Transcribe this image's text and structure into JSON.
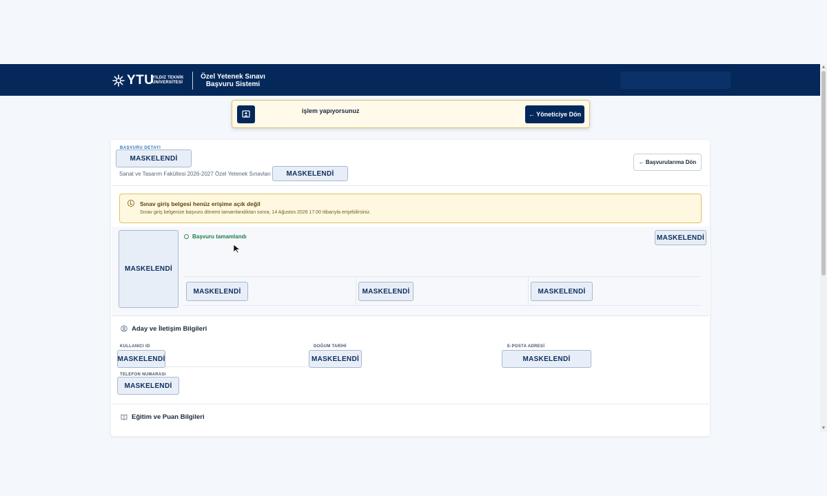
{
  "header": {
    "logo_text": "YTU",
    "university_name_line1": "YILDIZ TEKNİK",
    "university_name_line2": "ÜNİVERSİTESİ",
    "system_title_line1": "Özel Yetenek Sınavı",
    "system_title_line2": "Başvuru Sistemi"
  },
  "banner": {
    "text": "işlem yapıyorsunuz",
    "button_label": "← Yöneticiye Dön"
  },
  "card": {
    "eyebrow": "BAŞVURU DETAYI",
    "title_masked": "MASKELENDİ",
    "subtitle": "Sanat ve Tasarım Fakültesi 2026-2027 Özel Yetenek Sınavları",
    "subtitle_masked": "MASKELENDİ",
    "back_button_label": "← Başvurularıma Dön"
  },
  "warning": {
    "title": "Sınav giriş belgesi henüz erişime açık değil",
    "description": "Sınav giriş belgenize başvuru dönemi tamamlandıktan sonra, 14 Ağustos 2026 17:00 itibarıyla erişebilirsiniz."
  },
  "status": {
    "photo_masked": "MASKELENDİ",
    "status_text": "Başvuru tamamlandı",
    "top_right_masked": "MASKELENDİ",
    "stats": [
      "MASKELENDİ",
      "MASKELENDİ",
      "MASKELENDİ"
    ]
  },
  "contact_section": {
    "title": "Aday ve İletişim Bilgileri",
    "fields": [
      {
        "label": "KULLANICI ID",
        "value": "MASKELENDİ"
      },
      {
        "label": "DOĞUM TARİHİ",
        "value": "MASKELENDİ"
      },
      {
        "label": "E-POSTA ADRESİ",
        "value": "MASKELENDİ"
      },
      {
        "label": "TELEFON NUMARASI",
        "value": "MASKELENDİ"
      }
    ]
  },
  "education_section": {
    "title": "Eğitim ve Puan Bilgileri"
  },
  "colors": {
    "header_bg": "#04285a",
    "banner_bg": "#fffaea",
    "warning_bg": "#fff8e1",
    "success": "#1f7a4c"
  }
}
